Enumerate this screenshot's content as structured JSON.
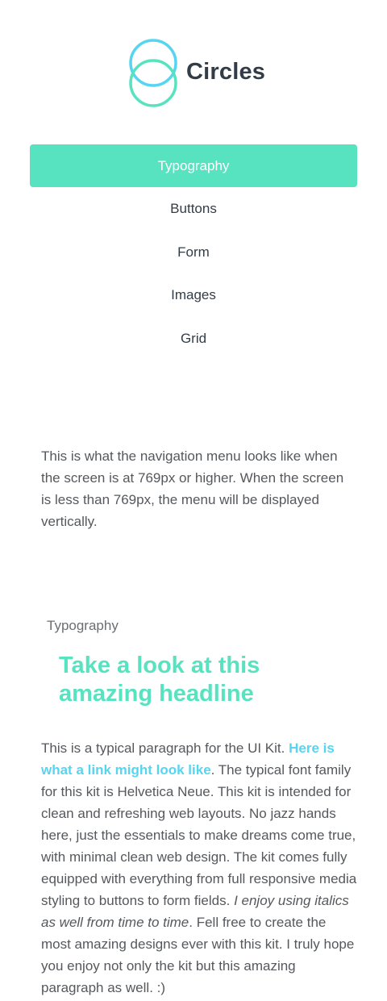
{
  "brand": {
    "name": "Circles",
    "accent": "#57e2c0",
    "accent_secondary": "#55d5f0",
    "logo_icon": "overlapping-circles-icon"
  },
  "nav": {
    "items": [
      {
        "label": "Typography",
        "active": true
      },
      {
        "label": "Buttons",
        "active": false
      },
      {
        "label": "Form",
        "active": false
      },
      {
        "label": "Images",
        "active": false
      },
      {
        "label": "Grid",
        "active": false
      }
    ]
  },
  "note": "This is what the navigation menu looks like when the screen is at 769px or higher. When the screen is less than 769px, the menu will be displayed vertically.",
  "typography": {
    "label": "Typography",
    "headline": "Take a look at this amazing headline",
    "paragraph": {
      "intro": "This is a typical paragraph for the UI Kit. ",
      "link": "Here is what a link might look like",
      "middle": ". The typical font family for this kit is Helvetica Neue. This kit is intended for clean and refreshing web layouts. No jazz hands here, just the essentials to make dreams come true, with minimal clean web design. The kit comes fully equipped with everything from full responsive media styling to buttons to form fields. ",
      "italic": "I enjoy using italics as well from time to time",
      "outro": ". Fell free to create the most amazing designs ever with this kit. I truly hope you enjoy not only the kit but this amazing paragraph as well. :)"
    }
  }
}
